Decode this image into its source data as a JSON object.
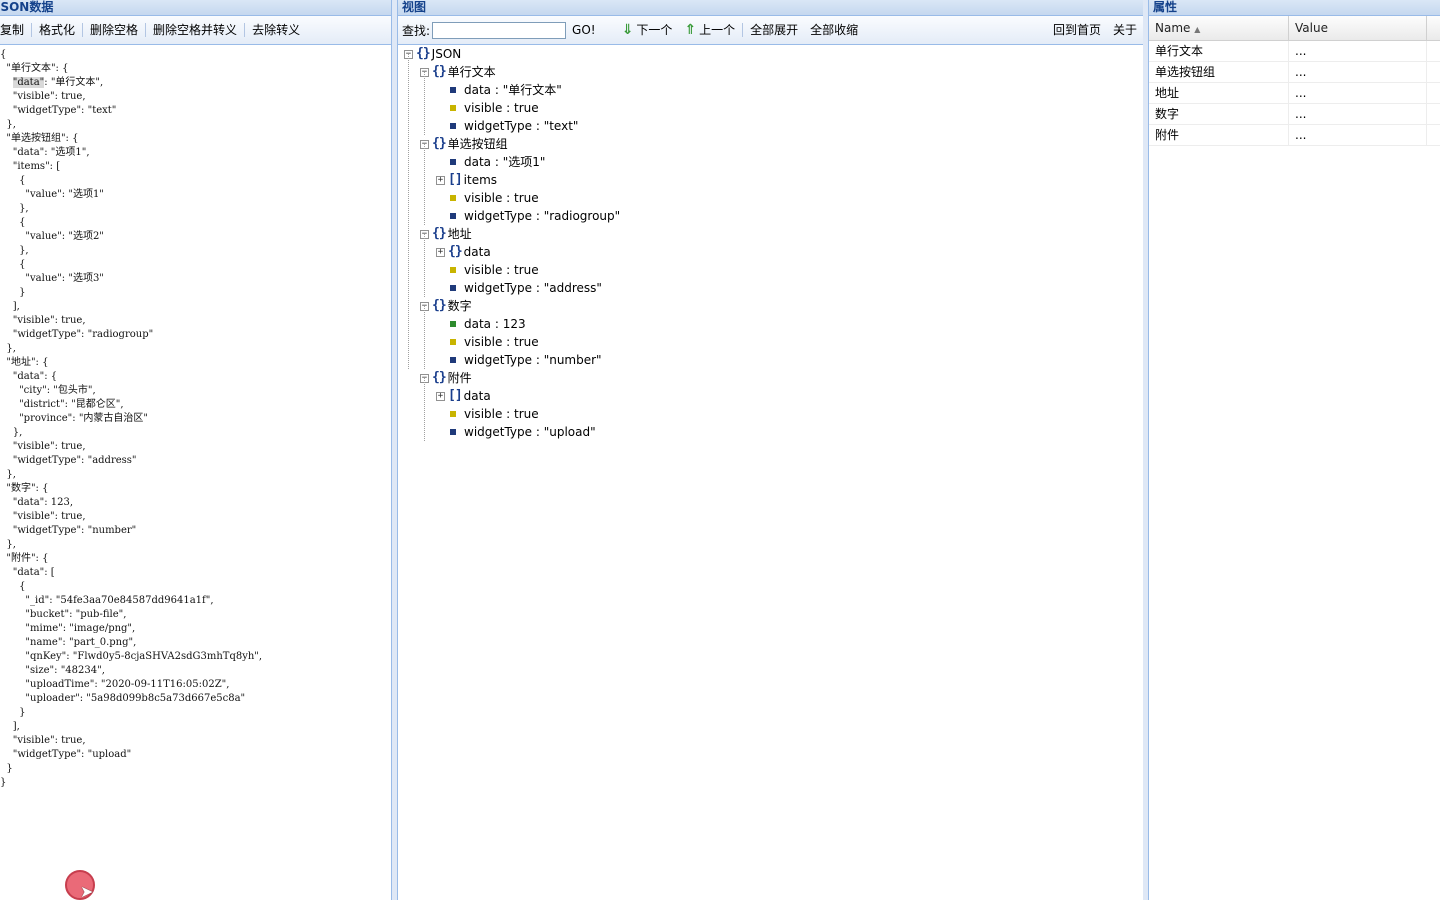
{
  "json_panel": {
    "title": "JSON数据",
    "toolbar": [
      "复制",
      "格式化",
      "删除空格",
      "删除空格并转义",
      "去除转义"
    ],
    "code_lines": [
      "{",
      "  \"单行文本\": {",
      "    \"data\": \"单行文本\",",
      "    \"visible\": true,",
      "    \"widgetType\": \"text\"",
      "  },",
      "  \"单选按钮组\": {",
      "    \"data\": \"选项1\",",
      "    \"items\": [",
      "      {",
      "        \"value\": \"选项1\"",
      "      },",
      "      {",
      "        \"value\": \"选项2\"",
      "      },",
      "      {",
      "        \"value\": \"选项3\"",
      "      }",
      "    ],",
      "    \"visible\": true,",
      "    \"widgetType\": \"radiogroup\"",
      "  },",
      "  \"地址\": {",
      "    \"data\": {",
      "      \"city\": \"包头市\",",
      "      \"district\": \"昆都仑区\",",
      "      \"province\": \"内蒙古自治区\"",
      "    },",
      "    \"visible\": true,",
      "    \"widgetType\": \"address\"",
      "  },",
      "  \"数字\": {",
      "    \"data\": 123,",
      "    \"visible\": true,",
      "    \"widgetType\": \"number\"",
      "  },",
      "  \"附件\": {",
      "    \"data\": [",
      "      {",
      "        \"_id\": \"54fe3aa70e84587dd9641a1f\",",
      "        \"bucket\": \"pub-file\",",
      "        \"mime\": \"image/png\",",
      "        \"name\": \"part_0.png\",",
      "        \"qnKey\": \"Flwd0y5-8cjaSHVA2sdG3mhTq8yh\",",
      "        \"size\": \"48234\",",
      "        \"uploadTime\": \"2020-09-11T16:05:02Z\",",
      "        \"uploader\": \"5a98d099b8c5a73d667e5c8a\"",
      "      }",
      "    ],",
      "    \"visible\": true,",
      "    \"widgetType\": \"upload\"",
      "  }",
      "}"
    ]
  },
  "view_panel": {
    "title": "视图",
    "search_label": "查找:",
    "search_value": "",
    "go_label": "GO!",
    "next_label": "下一个",
    "prev_label": "上一个",
    "expand_all_label": "全部展开",
    "collapse_all_label": "全部收缩",
    "home_label": "回到首页",
    "about_label": "关于",
    "tree": [
      {
        "depth": 0,
        "kind": "object",
        "toggle": "minus",
        "label": "JSON"
      },
      {
        "depth": 1,
        "kind": "object",
        "toggle": "minus",
        "label": "单行文本"
      },
      {
        "depth": 2,
        "kind": "leaf",
        "color": "#1f3a7a",
        "label": "data : \"单行文本\""
      },
      {
        "depth": 2,
        "kind": "leaf",
        "color": "#c8b400",
        "label": "visible : true"
      },
      {
        "depth": 2,
        "kind": "leaf",
        "color": "#1f3a7a",
        "label": "widgetType : \"text\""
      },
      {
        "depth": 1,
        "kind": "object",
        "toggle": "minus",
        "label": "单选按钮组"
      },
      {
        "depth": 2,
        "kind": "leaf",
        "color": "#1f3a7a",
        "label": "data : \"选项1\""
      },
      {
        "depth": 2,
        "kind": "array",
        "toggle": "plus",
        "label": "items"
      },
      {
        "depth": 2,
        "kind": "leaf",
        "color": "#c8b400",
        "label": "visible : true"
      },
      {
        "depth": 2,
        "kind": "leaf",
        "color": "#1f3a7a",
        "label": "widgetType : \"radiogroup\""
      },
      {
        "depth": 1,
        "kind": "object",
        "toggle": "minus",
        "label": "地址"
      },
      {
        "depth": 2,
        "kind": "object",
        "toggle": "plus",
        "label": "data"
      },
      {
        "depth": 2,
        "kind": "leaf",
        "color": "#c8b400",
        "label": "visible : true"
      },
      {
        "depth": 2,
        "kind": "leaf",
        "color": "#1f3a7a",
        "label": "widgetType : \"address\""
      },
      {
        "depth": 1,
        "kind": "object",
        "toggle": "minus",
        "label": "数字"
      },
      {
        "depth": 2,
        "kind": "leaf",
        "color": "#2e8b2e",
        "label": "data : 123"
      },
      {
        "depth": 2,
        "kind": "leaf",
        "color": "#c8b400",
        "label": "visible : true"
      },
      {
        "depth": 2,
        "kind": "leaf",
        "color": "#1f3a7a",
        "label": "widgetType : \"number\""
      },
      {
        "depth": 1,
        "kind": "object",
        "toggle": "minus",
        "label": "附件"
      },
      {
        "depth": 2,
        "kind": "array",
        "toggle": "plus",
        "label": "data"
      },
      {
        "depth": 2,
        "kind": "leaf",
        "color": "#c8b400",
        "label": "visible : true"
      },
      {
        "depth": 2,
        "kind": "leaf",
        "color": "#1f3a7a",
        "label": "widgetType : \"upload\""
      }
    ]
  },
  "prop_panel": {
    "title": "属性",
    "col_name": "Name",
    "col_value": "Value",
    "rows": [
      {
        "name": "单行文本",
        "value": "..."
      },
      {
        "name": "单选按钮组",
        "value": "..."
      },
      {
        "name": "地址",
        "value": "..."
      },
      {
        "name": "数字",
        "value": "..."
      },
      {
        "name": "附件",
        "value": "..."
      }
    ]
  }
}
